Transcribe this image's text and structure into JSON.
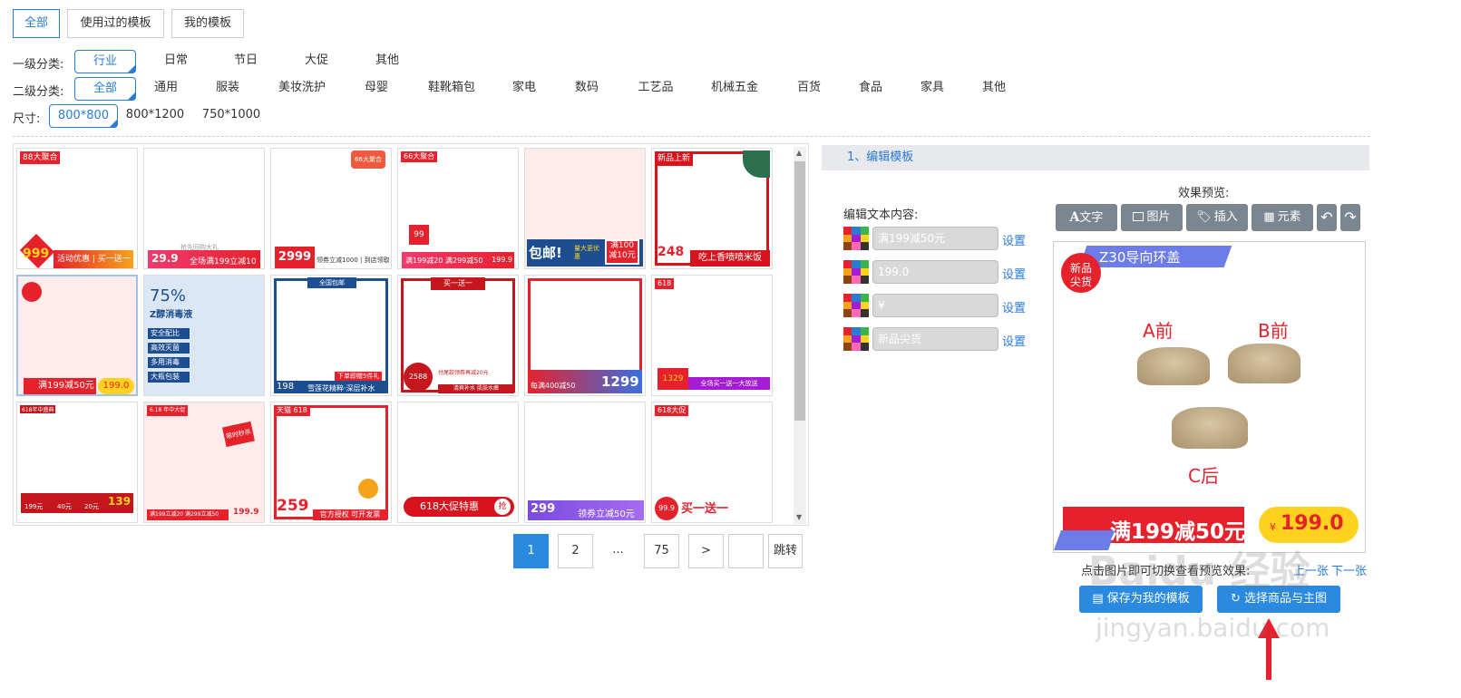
{
  "tabs": [
    {
      "label": "全部",
      "active": true
    },
    {
      "label": "使用过的模板",
      "active": false
    },
    {
      "label": "我的模板",
      "active": false
    }
  ],
  "filters": {
    "level1_label": "一级分类:",
    "level1": [
      "行业",
      "日常",
      "节日",
      "大促",
      "其他"
    ],
    "level2_label": "二级分类:",
    "level2": [
      "全部",
      "通用",
      "服装",
      "美妆洗护",
      "母婴",
      "鞋靴箱包",
      "家电",
      "数码",
      "工艺品",
      "机械五金",
      "百货",
      "食品",
      "家具",
      "其他"
    ],
    "size_label": "尺寸:",
    "sizes": [
      "800*800",
      "800*1200",
      "750*1000"
    ]
  },
  "thumbs": {
    "t1": {
      "tag": "88大聚合",
      "price": "999",
      "text": "活动优惠 | 买一送一"
    },
    "t2": {
      "price": "29.9",
      "text": "全场满199立减10",
      "sub": "抢先回购大礼"
    },
    "t3": {
      "tag": "66大聚合",
      "price": "2999",
      "text": "领券立减1000 | 到店领取"
    },
    "t4": {
      "tag": "66大聚合",
      "badge": "99",
      "text": "满199减20 满299减50",
      "price": "199.9"
    },
    "t5": {
      "text1": "包邮!",
      "text2": "量大更优惠",
      "text3": "满100减10元"
    },
    "t6": {
      "tag": "新品上新",
      "price": "248",
      "text": "吃上香喷喷米饭"
    },
    "t7": {
      "text": "满199减50元",
      "price": "199.0"
    },
    "t8": {
      "big": "75%",
      "sub": "Z醇消毒液",
      "items": [
        "安全配比",
        "高效灭菌",
        "多用消毒",
        "大瓶包装"
      ]
    },
    "t9": {
      "top": "全国包邮",
      "price": "198",
      "text": "雪莲花精粹·深层补水",
      "sub": "下单即赠5件礼"
    },
    "t10": {
      "top": "买一送一",
      "price": "2588",
      "text": "清爽补水 肌肤水嫩",
      "sub": "付尾款领券再减20元"
    },
    "t11": {
      "text": "每满400减50",
      "price": "1299"
    },
    "t12": {
      "tag": "618",
      "price": "1329",
      "text": "全场买一送一大放送"
    },
    "t13": {
      "tag": "618年中盛典",
      "prices": [
        "199元",
        "40元",
        "20元",
        "139"
      ]
    },
    "t14": {
      "tag": "6.18 年中大促",
      "stamp": "限时秒杀",
      "text": "满199立减20 满299立减50",
      "price": "199.9"
    },
    "t15": {
      "tag": "天猫 618",
      "price": "259",
      "text": "官方授权 可开发票"
    },
    "t16": {
      "text": "618大促特惠",
      "btn": "抢"
    },
    "t17": {
      "price": "299",
      "text": "领券立减50元"
    },
    "t18": {
      "tag": "618大促",
      "price": "99.9",
      "text": "买一送一"
    }
  },
  "pagination": {
    "pages": [
      "1",
      "2",
      "...",
      "75",
      ">"
    ],
    "jump": "跳转"
  },
  "editor": {
    "section_title": "1、编辑模板",
    "edit_label": "编辑文本内容:",
    "preview_label": "效果预览:",
    "fields": [
      {
        "value": "满199减50元",
        "set": "设置"
      },
      {
        "value": "199.0",
        "set": "设置"
      },
      {
        "value": "¥",
        "set": "设置"
      },
      {
        "value": "新品尖货",
        "set": "设置"
      }
    ],
    "toolbar": {
      "text": "文字",
      "image": "图片",
      "insert": "插入",
      "element": "元素"
    },
    "preview": {
      "badge1": "新品",
      "badge2": "尖货",
      "title": "Z30导向环盖",
      "label_a": "A前",
      "label_b": "B前",
      "label_c": "C后",
      "promo": "满199减50元",
      "currency": "¥",
      "price": "199.0"
    },
    "hint": "点击图片即可切换查看预览效果:",
    "prev": "上一张",
    "next": "下一张",
    "save_btn": "保存为我的模板",
    "select_btn": "选择商品与主图"
  },
  "watermark": {
    "brand": "Baidu 经验",
    "url": "jingyan.baidu.com"
  },
  "colors": {
    "accent": "#2a7bd6",
    "red": "#e5222c",
    "yellow": "#ffd21f"
  }
}
